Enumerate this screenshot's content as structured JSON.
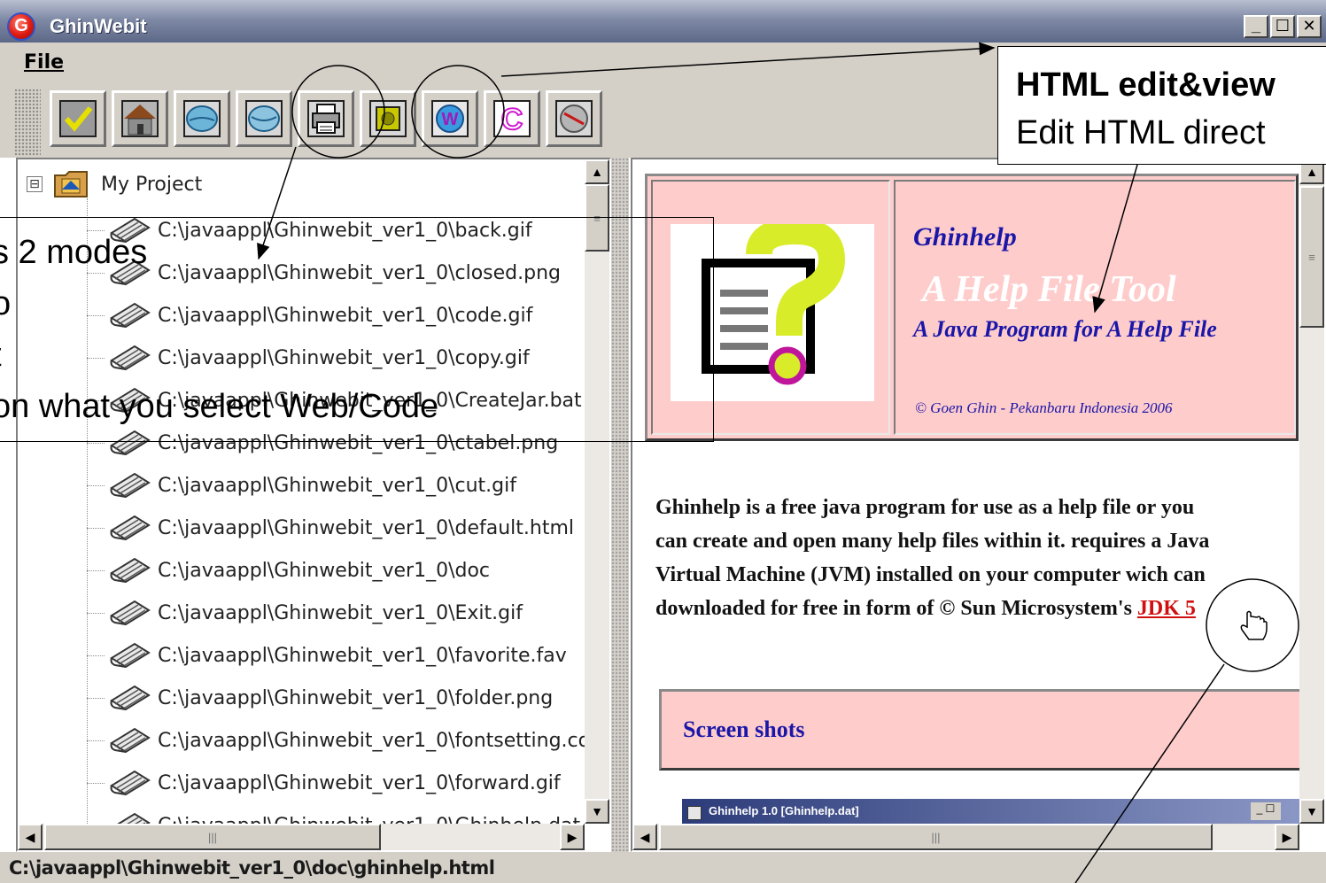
{
  "window": {
    "title": "GhinWebit",
    "logo_glyph": "G",
    "min_glyph": "_",
    "max_glyph": "☐",
    "close_glyph": "✕"
  },
  "menu": {
    "file_label": "File"
  },
  "toolbar": {
    "buttons": [
      {
        "icon": "check-icon"
      },
      {
        "icon": "home-icon"
      },
      {
        "icon": "back-icon"
      },
      {
        "icon": "forward-icon"
      },
      {
        "icon": "print-icon"
      },
      {
        "icon": "image-icon"
      },
      {
        "icon": "web-mode-icon"
      },
      {
        "icon": "code-mode-icon"
      },
      {
        "icon": "exit-icon"
      }
    ]
  },
  "tree": {
    "root_label": "My Project",
    "expander": "⊟",
    "items": [
      "C:\\javaappl\\Ghinwebit_ver1_0\\back.gif",
      "C:\\javaappl\\Ghinwebit_ver1_0\\closed.png",
      "C:\\javaappl\\Ghinwebit_ver1_0\\code.gif",
      "C:\\javaappl\\Ghinwebit_ver1_0\\copy.gif",
      "C:\\javaappl\\Ghinwebit_ver1_0\\CreateJar.bat",
      "C:\\javaappl\\Ghinwebit_ver1_0\\ctabel.png",
      "C:\\javaappl\\Ghinwebit_ver1_0\\cut.gif",
      "C:\\javaappl\\Ghinwebit_ver1_0\\default.html",
      "C:\\javaappl\\Ghinwebit_ver1_0\\doc",
      "C:\\javaappl\\Ghinwebit_ver1_0\\Exit.gif",
      "C:\\javaappl\\Ghinwebit_ver1_0\\favorite.fav",
      "C:\\javaappl\\Ghinwebit_ver1_0\\folder.png",
      "C:\\javaappl\\Ghinwebit_ver1_0\\fontsetting.conf",
      "C:\\javaappl\\Ghinwebit_ver1_0\\forward.gif",
      "C:\\javaappl\\Ghinwebit_ver1_0\\Ghinhelp.dat"
    ]
  },
  "scroll": {
    "up": "▲",
    "down": "▼",
    "left": "◀",
    "right": "▶",
    "grip_v": "≡",
    "grip_h": "|||"
  },
  "html_view": {
    "header_name": "Ghinhelp",
    "header_subtitle": "A Help File Tool",
    "header_tagline": "A Java Program for A Help File",
    "header_copyright": "© Goen Ghin - Pekanbaru Indonesia 2006",
    "description_lines": [
      "Ghinhelp is a free java program for use as a help file or you",
      "can create and open many help files within it. requires a Java",
      "Virtual Machine (JVM) installed on your computer wich can",
      "downloaded for free in form of © Sun Microsystem's"
    ],
    "jdk_link": "JDK 5",
    "screenshots_label": "Screen shots",
    "mini_window_title": "Ghinhelp 1.0 [Ghinhelp.dat]",
    "mini_window_btns": "_ ☐"
  },
  "status": {
    "path": "C:\\javaappl\\Ghinwebit_ver1_0\\doc\\ghinhelp.html"
  },
  "callouts": {
    "right_title": "HTML edit&view",
    "right_body": "Edit HTML direct",
    "left_lines": [
      "s 2 modes",
      "o",
      "t",
      "on what you select Web/Code"
    ]
  },
  "colors": {
    "titlebar": "#5c6887",
    "panel_bg": "#d4d0c8",
    "banner_pink": "#ffcccc",
    "heading_blue": "#1a17a8",
    "link_red": "#d01010"
  }
}
